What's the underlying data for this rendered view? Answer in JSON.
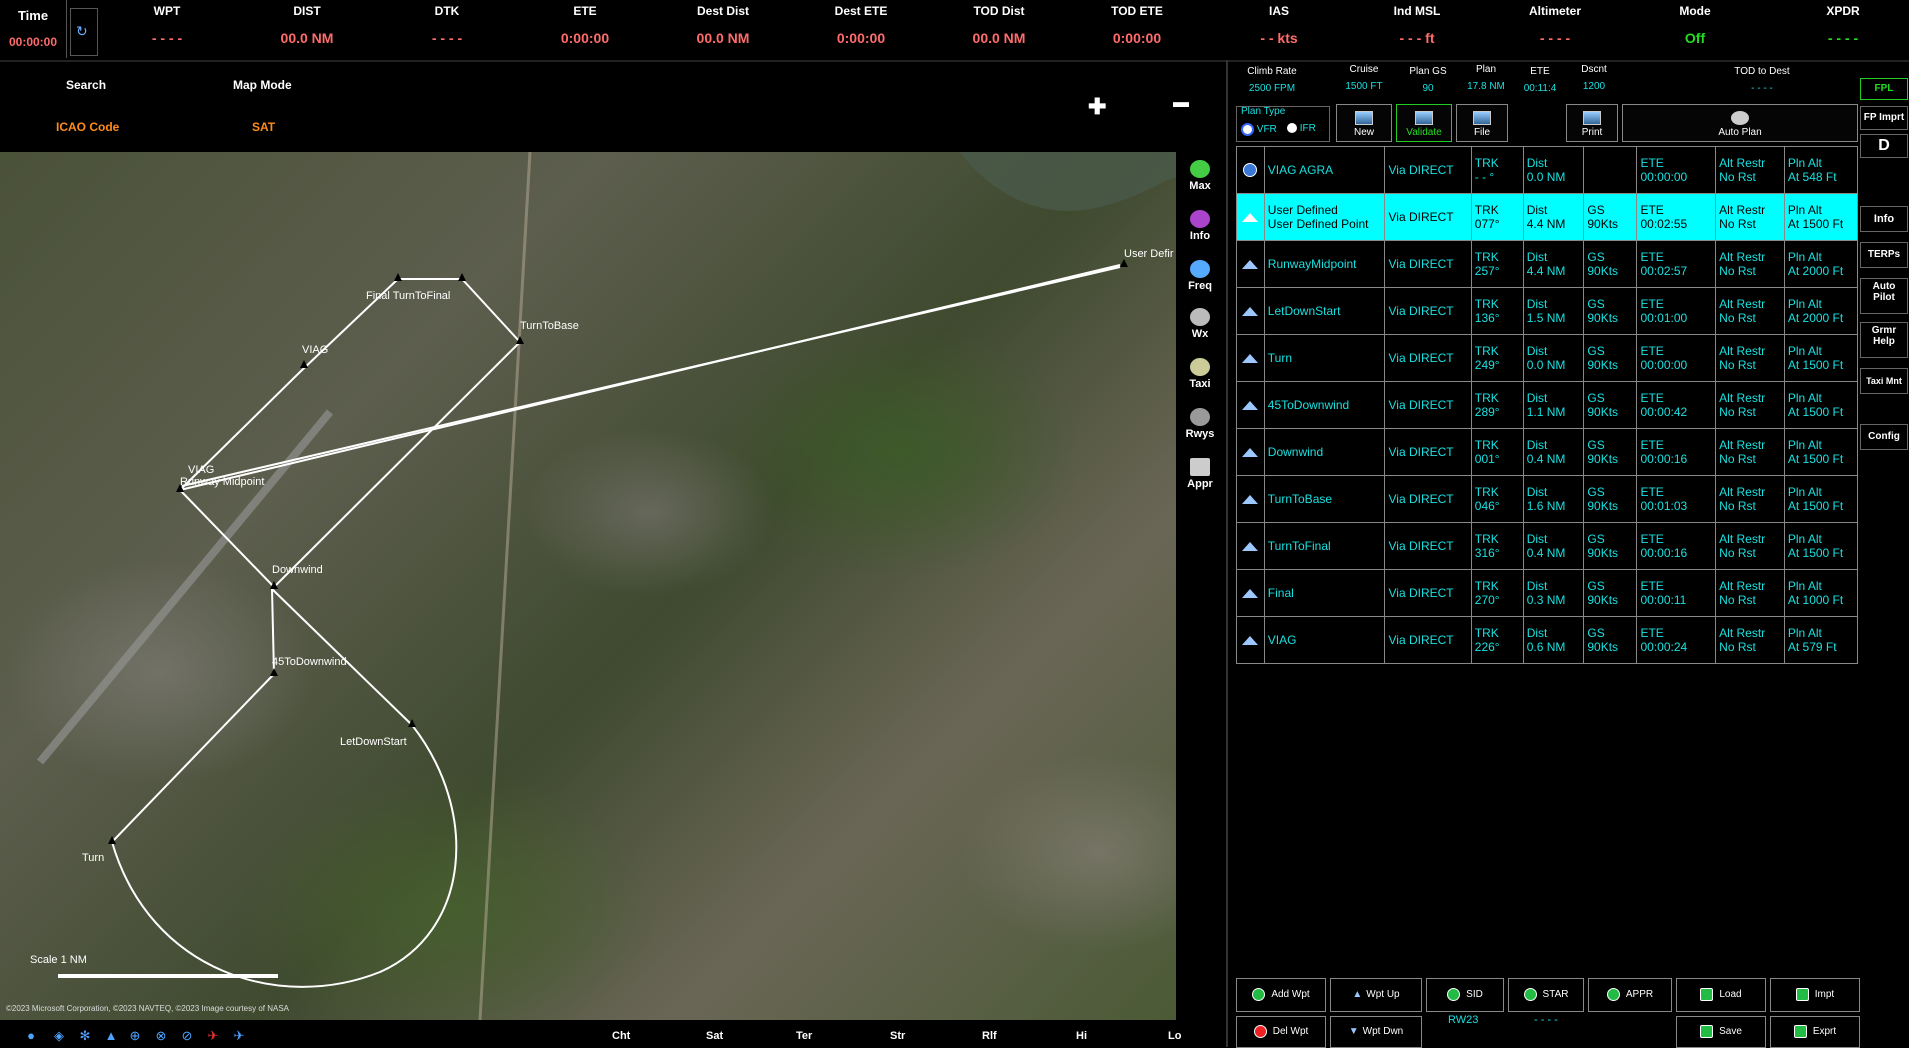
{
  "topbar": {
    "time": {
      "label": "Time",
      "value": "00:00:00"
    },
    "cells": [
      {
        "label": "WPT",
        "value": "- - - -",
        "color": "red"
      },
      {
        "label": "DIST",
        "value": "00.0 NM",
        "color": "red"
      },
      {
        "label": "DTK",
        "value": "- - - -",
        "color": "red"
      },
      {
        "label": "ETE",
        "value": "0:00:00",
        "color": "red"
      },
      {
        "label": "Dest Dist",
        "value": "00.0 NM",
        "color": "red"
      },
      {
        "label": "Dest ETE",
        "value": "0:00:00",
        "color": "red"
      },
      {
        "label": "TOD Dist",
        "value": "00.0 NM",
        "color": "red"
      },
      {
        "label": "TOD ETE",
        "value": "0:00:00",
        "color": "red"
      },
      {
        "label": "IAS",
        "value": "- - kts",
        "color": "red"
      },
      {
        "label": "Ind MSL",
        "value": "- - - ft",
        "color": "red"
      },
      {
        "label": "Altimeter",
        "value": "- - - -",
        "color": "red"
      },
      {
        "label": "Mode",
        "value": "Off",
        "color": "green"
      },
      {
        "label": "XPDR",
        "value": "- - - -",
        "color": "green"
      }
    ]
  },
  "map_header": {
    "search_label": "Search",
    "search_value": "ICAO Code",
    "mode_label": "Map Mode",
    "mode_value": "SAT",
    "zoom_in": "✚",
    "zoom_out": "▬"
  },
  "map": {
    "waypoints": [
      "Final TurnToFinal",
      "TurnToBase",
      "VIAG",
      "VIAG",
      "Runway Midpoint",
      "Downwind",
      "45ToDownwind",
      "LetDownStart",
      "Turn",
      "User Defir"
    ],
    "scale_label": "Scale 1 NM",
    "copyright": "©2023 Microsoft Corporation, ©2023 NAVTEQ, ©2023 Image courtesy of NASA"
  },
  "map_tools": [
    "Max",
    "Info",
    "Freq",
    "Wx",
    "Taxi",
    "Rwys",
    "Appr"
  ],
  "bottom_bar": {
    "labels": [
      "Cht",
      "Sat",
      "Ter",
      "Str",
      "Rlf",
      "Hi",
      "Lo"
    ]
  },
  "plan_header": {
    "cells": [
      {
        "label": "Climb Rate",
        "value": "2500 FPM"
      },
      {
        "label": "Cruise",
        "value": "1500 FT"
      },
      {
        "label": "Plan GS",
        "value": "90"
      },
      {
        "label": "Plan",
        "value": "17.8 NM"
      },
      {
        "label": "ETE",
        "value": "00:11:4"
      },
      {
        "label": "Dscnt",
        "value": "1200"
      },
      {
        "label": "TOD to Dest",
        "value": "- - - -"
      }
    ]
  },
  "plan_type": {
    "label": "Plan Type",
    "vfr": "VFR",
    "ifr": "IFR"
  },
  "plan_buttons": {
    "new": "New",
    "validate": "Validate",
    "file": "File",
    "print": "Print",
    "auto_plan": "Auto Plan"
  },
  "fpl_rows": [
    {
      "name": "VIAG  AGRA",
      "name2": "",
      "via": "Via DIRECT",
      "trk": "TRK",
      "trk2": "- - °",
      "dist": "Dist",
      "dist2": "0.0 NM",
      "gs": "",
      "gs2": "",
      "ete": "ETE",
      "ete2": "00:00:00",
      "alt": "Alt Restr",
      "alt2": "No Rst",
      "pln": "Pln Alt",
      "pln2": "At 548 Ft",
      "icon": "globe",
      "selected": false
    },
    {
      "name": "User Defined",
      "name2": "User Defined Point",
      "via": "Via DIRECT",
      "trk": "TRK",
      "trk2": "077°",
      "dist": "Dist",
      "dist2": "4.4 NM",
      "gs": "GS",
      "gs2": "90Kts",
      "ete": "ETE",
      "ete2": "00:02:55",
      "alt": "Alt Restr",
      "alt2": "No Rst",
      "pln": "Pln Alt",
      "pln2": "At 1500 Ft",
      "icon": "tri",
      "selected": true
    },
    {
      "name": "RunwayMidpoint",
      "name2": "",
      "via": "Via DIRECT",
      "trk": "TRK",
      "trk2": "257°",
      "dist": "Dist",
      "dist2": "4.4 NM",
      "gs": "GS",
      "gs2": "90Kts",
      "ete": "ETE",
      "ete2": "00:02:57",
      "alt": "Alt Restr",
      "alt2": "No Rst",
      "pln": "Pln Alt",
      "pln2": "At 2000 Ft",
      "icon": "tri",
      "selected": false
    },
    {
      "name": "LetDownStart",
      "name2": "",
      "via": "Via DIRECT",
      "trk": "TRK",
      "trk2": "136°",
      "dist": "Dist",
      "dist2": "1.5 NM",
      "gs": "GS",
      "gs2": "90Kts",
      "ete": "ETE",
      "ete2": "00:01:00",
      "alt": "Alt Restr",
      "alt2": "No Rst",
      "pln": "Pln Alt",
      "pln2": "At 2000 Ft",
      "icon": "tri",
      "selected": false
    },
    {
      "name": "Turn",
      "name2": "",
      "via": "Via DIRECT",
      "trk": "TRK",
      "trk2": "249°",
      "dist": "Dist",
      "dist2": "0.0 NM",
      "gs": "GS",
      "gs2": "90Kts",
      "ete": "ETE",
      "ete2": "00:00:00",
      "alt": "Alt Restr",
      "alt2": "No Rst",
      "pln": "Pln Alt",
      "pln2": "At 1500 Ft",
      "icon": "tri",
      "selected": false
    },
    {
      "name": "45ToDownwind",
      "name2": "",
      "via": "Via DIRECT",
      "trk": "TRK",
      "trk2": "289°",
      "dist": "Dist",
      "dist2": "1.1 NM",
      "gs": "GS",
      "gs2": "90Kts",
      "ete": "ETE",
      "ete2": "00:00:42",
      "alt": "Alt Restr",
      "alt2": "No Rst",
      "pln": "Pln Alt",
      "pln2": "At 1500 Ft",
      "icon": "tri",
      "selected": false
    },
    {
      "name": "Downwind",
      "name2": "",
      "via": "Via DIRECT",
      "trk": "TRK",
      "trk2": "001°",
      "dist": "Dist",
      "dist2": "0.4 NM",
      "gs": "GS",
      "gs2": "90Kts",
      "ete": "ETE",
      "ete2": "00:00:16",
      "alt": "Alt Restr",
      "alt2": "No Rst",
      "pln": "Pln Alt",
      "pln2": "At 1500 Ft",
      "icon": "tri",
      "selected": false
    },
    {
      "name": "TurnToBase",
      "name2": "",
      "via": "Via DIRECT",
      "trk": "TRK",
      "trk2": "046°",
      "dist": "Dist",
      "dist2": "1.6 NM",
      "gs": "GS",
      "gs2": "90Kts",
      "ete": "ETE",
      "ete2": "00:01:03",
      "alt": "Alt Restr",
      "alt2": "No Rst",
      "pln": "Pln Alt",
      "pln2": "At 1500 Ft",
      "icon": "tri",
      "selected": false
    },
    {
      "name": "TurnToFinal",
      "name2": "",
      "via": "Via DIRECT",
      "trk": "TRK",
      "trk2": "316°",
      "dist": "Dist",
      "dist2": "0.4 NM",
      "gs": "GS",
      "gs2": "90Kts",
      "ete": "ETE",
      "ete2": "00:00:16",
      "alt": "Alt Restr",
      "alt2": "No Rst",
      "pln": "Pln Alt",
      "pln2": "At 1500 Ft",
      "icon": "tri",
      "selected": false
    },
    {
      "name": "Final",
      "name2": "",
      "via": "Via DIRECT",
      "trk": "TRK",
      "trk2": "270°",
      "dist": "Dist",
      "dist2": "0.3 NM",
      "gs": "GS",
      "gs2": "90Kts",
      "ete": "ETE",
      "ete2": "00:00:11",
      "alt": "Alt Restr",
      "alt2": "No Rst",
      "pln": "Pln Alt",
      "pln2": "At 1000 Ft",
      "icon": "tri",
      "selected": false
    },
    {
      "name": "VIAG",
      "name2": "",
      "via": "Via DIRECT",
      "trk": "TRK",
      "trk2": "226°",
      "dist": "Dist",
      "dist2": "0.6 NM",
      "gs": "GS",
      "gs2": "90Kts",
      "ete": "ETE",
      "ete2": "00:00:24",
      "alt": "Alt Restr",
      "alt2": "No Rst",
      "pln": "Pln Alt",
      "pln2": "At 579 Ft",
      "icon": "tri",
      "selected": false
    }
  ],
  "side_tabs": {
    "fpl": "FPL",
    "fp_import": "FP Imprt",
    "dto": "D",
    "info": "Info",
    "terps": "TERPs",
    "autopilot": "Auto Pilot",
    "grmr_help": "Grmr Help",
    "taxi_mnt": "Taxi Mnt",
    "config": "Config"
  },
  "bottom_buttons": {
    "add_wpt": "Add Wpt",
    "wpt_up": "Wpt Up",
    "sid": "SID",
    "star": "STAR",
    "appr": "APPR",
    "load": "Load",
    "impt": "Impt",
    "del_wpt": "Del Wpt",
    "wpt_dwn": "Wpt Dwn",
    "rw": "RW23",
    "sid_sel": "- - - -",
    "save": "Save",
    "exprt": "Exprt"
  },
  "colors": {
    "accent": "#19e0e0",
    "warn": "#ff6b6b",
    "ok": "#22dd22",
    "selected_row": "#00ffff"
  }
}
